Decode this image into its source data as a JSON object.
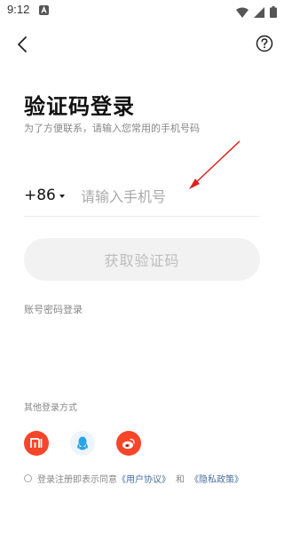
{
  "status_bar": {
    "time": "9:12"
  },
  "header": {
    "back_icon": "chevron-left-icon",
    "help_icon": "question-circle-icon"
  },
  "main": {
    "title": "验证码登录",
    "subtitle": "为了方便联系，请输入您常用的手机号码",
    "country_code": "+86",
    "phone_placeholder": "请输入手机号",
    "get_code_label": "获取验证码",
    "password_login_label": "账号密码登录"
  },
  "other_login": {
    "label": "其他登录方式",
    "providers": [
      "xiaomi-icon",
      "qq-icon",
      "weibo-icon"
    ]
  },
  "agreement": {
    "prefix": "登录注册即表示同意",
    "user_agreement": "《用户协议》",
    "and": "和",
    "privacy_policy": "《隐私政策》"
  },
  "colors": {
    "accent_red": "#f7452a",
    "link": "#4a6fa5",
    "annotation": "#e0201c"
  }
}
